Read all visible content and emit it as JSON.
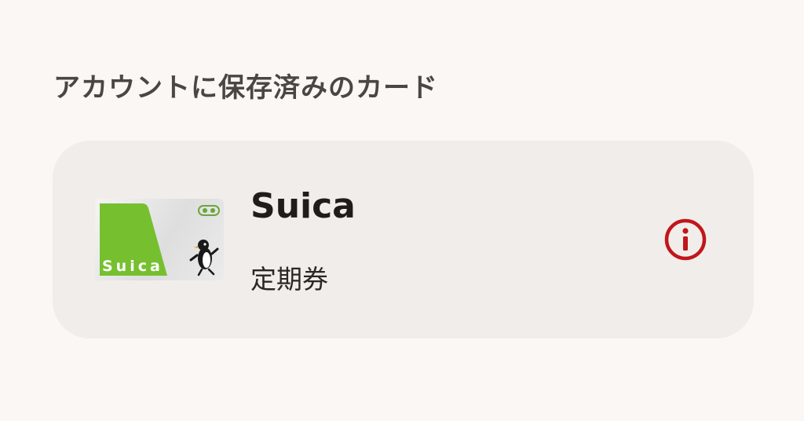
{
  "section": {
    "title": "アカウントに保存済みのカード"
  },
  "card": {
    "name": "Suica",
    "type": "定期券",
    "thumbnail_label": "Suica",
    "brand_color": "#76c02f",
    "info_icon": "info-icon",
    "info_color": "#c0161b"
  }
}
